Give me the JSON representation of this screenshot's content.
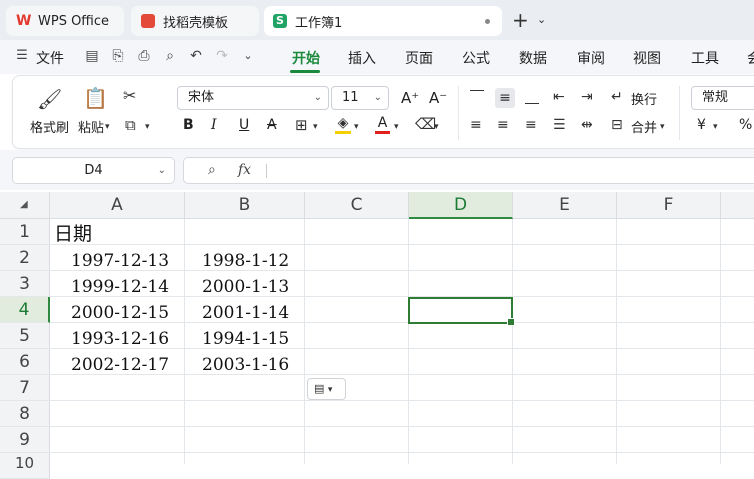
{
  "tabs": [
    {
      "label": "WPS Office",
      "icon": "wps-logo-icon"
    },
    {
      "label": "找稻壳模板",
      "icon": "daoke-icon"
    },
    {
      "label": "工作簿1",
      "icon": "spreadsheet-icon",
      "active": true
    }
  ],
  "menu": {
    "file": "文件",
    "tabs": [
      "开始",
      "插入",
      "页面",
      "公式",
      "数据",
      "审阅",
      "视图",
      "工具",
      "会"
    ],
    "active_tab": "开始"
  },
  "ribbon": {
    "format_painter": "格式刷",
    "paste": "粘贴",
    "font_name": "宋体",
    "font_size": "11",
    "wrap": "换行",
    "merge": "合并",
    "number_format": "常规",
    "currency": "¥",
    "percent": "%",
    "bold": "B",
    "italic": "I",
    "underline": "U",
    "strike": "A",
    "font_color_glyph": "A",
    "increase_font": "A⁺",
    "decrease_font": "A⁻"
  },
  "formula": {
    "cell_ref": "D4",
    "fx": "fx",
    "value": ""
  },
  "sheet": {
    "columns": [
      "A",
      "B",
      "C",
      "D",
      "E",
      "F"
    ],
    "rows": [
      "1",
      "2",
      "3",
      "4",
      "5",
      "6",
      "7",
      "8",
      "9",
      "10"
    ],
    "active_column": "D",
    "active_row": "4",
    "cells": {
      "A1": "日期",
      "A2": "1997-12-13",
      "B2": "1998-1-12",
      "A3": "1999-12-14",
      "B3": "2000-1-13",
      "A4": "2000-12-15",
      "B4": "2001-1-14",
      "A5": "1993-12-16",
      "B5": "1994-1-15",
      "A6": "2002-12-17",
      "B6": "2003-1-16"
    }
  },
  "colors": {
    "accent": "#1c8a3c",
    "selection": "#2f7d32",
    "spreadsheet": "#21a366"
  }
}
